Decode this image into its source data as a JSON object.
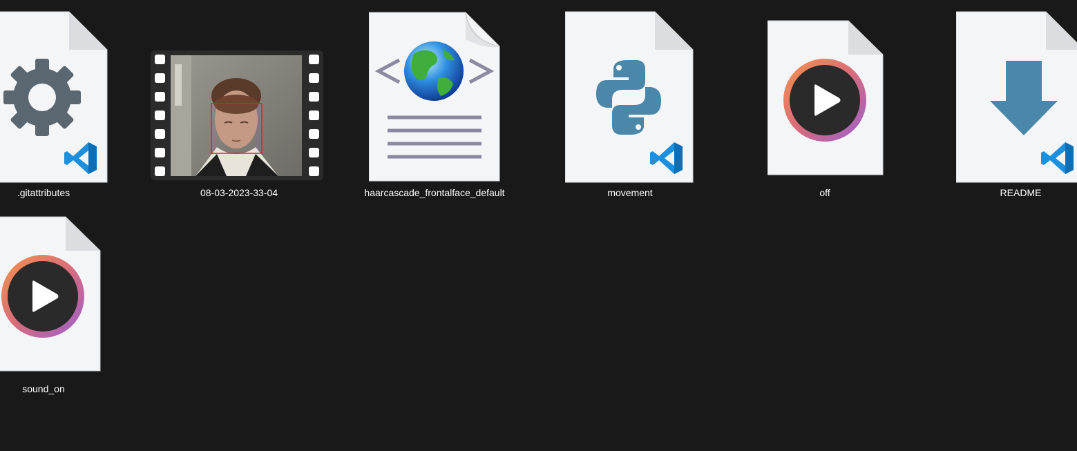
{
  "view": {
    "background": "#191919",
    "label_color": "#ffffff"
  },
  "files": [
    {
      "name": ".gitattributes",
      "icon": "gear-document-icon",
      "badge": "vscode-icon"
    },
    {
      "name": "08-03-2023-33-04",
      "icon": "video-thumbnail-icon",
      "badge": null
    },
    {
      "name": "haarcascade_frontalface_default",
      "icon": "xml-globe-document-icon",
      "badge": null
    },
    {
      "name": "movement",
      "icon": "python-document-icon",
      "badge": "vscode-icon"
    },
    {
      "name": "off",
      "icon": "media-player-document-icon",
      "badge": null
    },
    {
      "name": "README",
      "icon": "download-arrow-document-icon",
      "badge": "vscode-icon"
    },
    {
      "name": "sound_on",
      "icon": "media-player-document-icon",
      "badge": null
    }
  ],
  "colors": {
    "page": "#f4f5f7",
    "page_fold": "#dcdde0",
    "gear": "#5b6770",
    "python": "#4a87a8",
    "download_arrow": "#4a87a8",
    "vscode": "#1c8fdd",
    "media_ring_start": "#f5934a",
    "media_ring_end": "#9b5fcf",
    "media_core": "#2a2a2a",
    "xml_bracket": "#8a8aa0",
    "xml_lines": "#8a87a0",
    "face_box": "#e0241b"
  }
}
